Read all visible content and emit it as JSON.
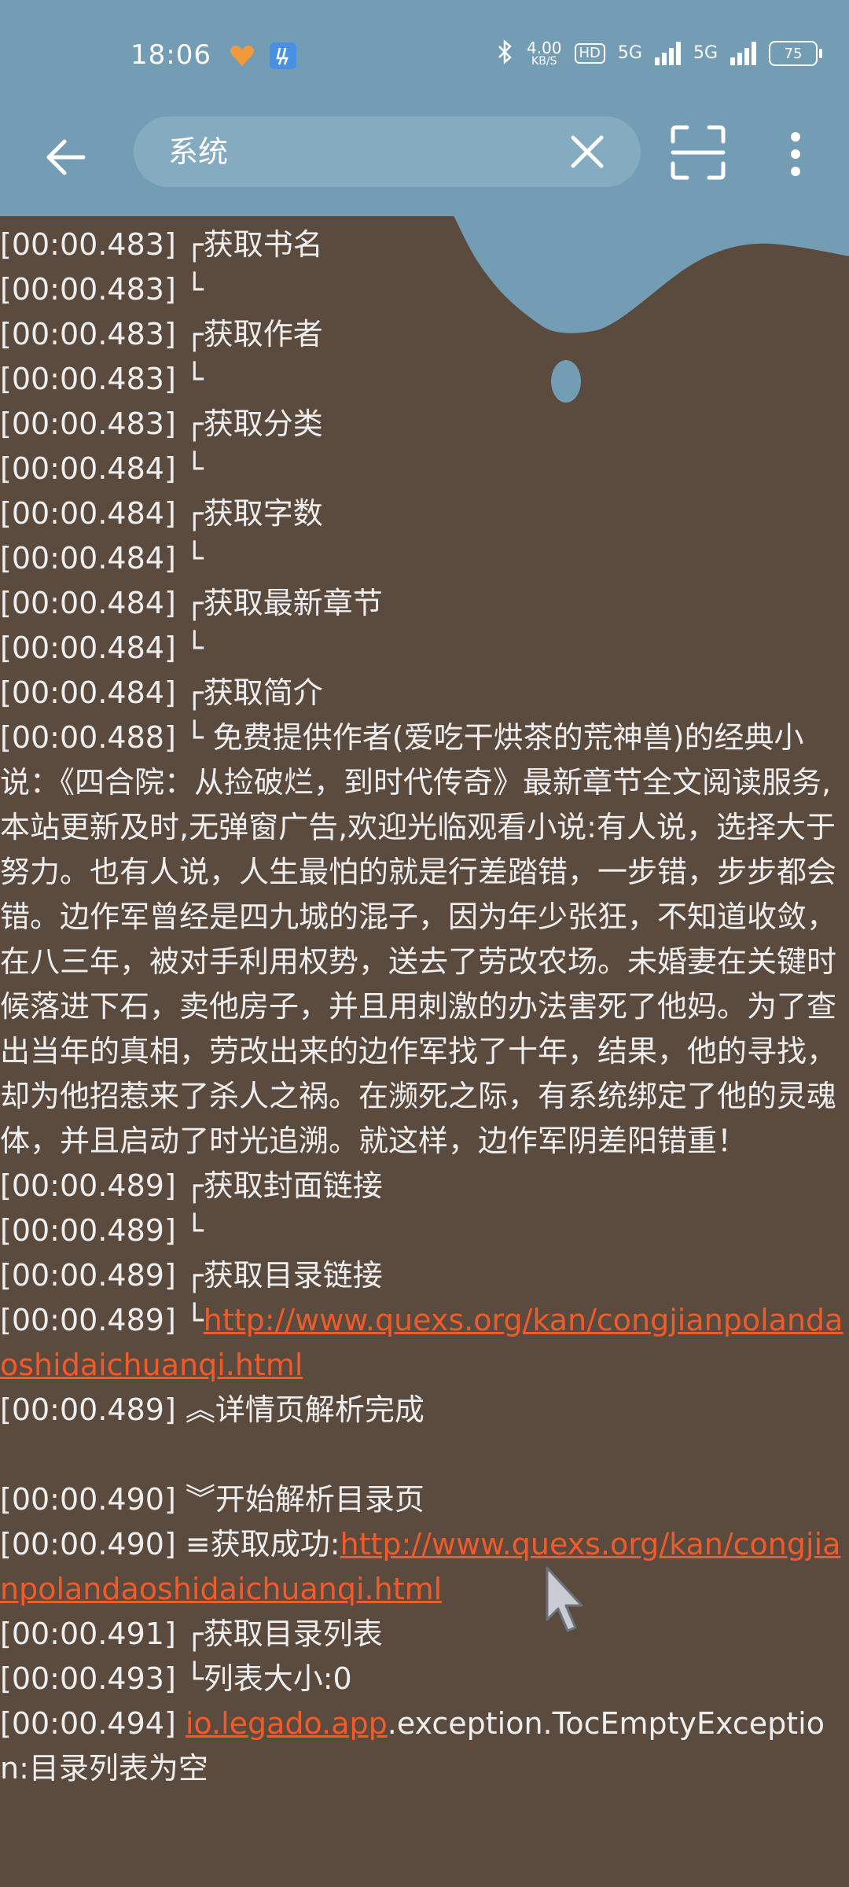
{
  "status": {
    "time": "18:06",
    "net_speed": "4.00",
    "net_unit": "KB/S",
    "hd": "HD",
    "signal1_label": "5G",
    "signal2_label": "5G",
    "battery": "75"
  },
  "search": {
    "value": "系统"
  },
  "colors": {
    "bar": "#739db4",
    "background": "#5b4a3e",
    "text": "#eeeeee",
    "link": "#ef5b2a"
  },
  "log": {
    "l1": "[00:00.483] ┌获取书名",
    "l2": "[00:00.483] └",
    "l3": "[00:00.483] ┌获取作者",
    "l4": "[00:00.483] └",
    "l5": "[00:00.483] ┌获取分类",
    "l6": "[00:00.484] └",
    "l7": "[00:00.484] ┌获取字数",
    "l8": "[00:00.484] └",
    "l9": "[00:00.484] ┌获取最新章节",
    "l10": "[00:00.484] └",
    "l11": "[00:00.484] ┌获取简介",
    "intro": "[00:00.488] └ 免费提供作者(爱吃干烘茶的荒神兽)的经典小说：《四合院：从捡破烂，到时代传奇》最新章节全文阅读服务,本站更新及时,无弹窗广告,欢迎光临观看小说:有人说，选择大于努力。也有人说，人生最怕的就是行差踏错，一步错，步步都会错。边作军曾经是四九城的混子，因为年少张狂，不知道收敛，在八三年，被对手利用权势，送去了劳改农场。未婚妻在关键时候落进下石，卖他房子，并且用刺激的办法害死了他妈。为了查出当年的真相，劳改出来的边作军找了十年，结果，他的寻找，却为他招惹来了杀人之祸。在濒死之际，有系统绑定了他的灵魂体，并且启动了时光追溯。就这样，边作军阴差阳错重！",
    "l12": "[00:00.489] ┌获取封面链接",
    "l13": "[00:00.489] └",
    "l14": "[00:00.489] ┌获取目录链接",
    "l15_prefix": "[00:00.489] └",
    "l15_link": "http://www.quexs.org/kan/congjianpolandaoshidaichuanqi.html",
    "l16": "[00:00.489] ︽详情页解析完成",
    "l17": "[00:00.490] ︾开始解析目录页",
    "l18_prefix": "[00:00.490] ≡获取成功:",
    "l18_link": "http://www.quexs.org/kan/congjianpolandaoshidaichuanqi.html",
    "l19": "[00:00.491] ┌获取目录列表",
    "l20": "[00:00.493] └列表大小:0",
    "l21_prefix": "[00:00.494] ",
    "l21_link": "io.legado.app",
    "l21_suffix": ".exception.TocEmptyException:目录列表为空"
  }
}
